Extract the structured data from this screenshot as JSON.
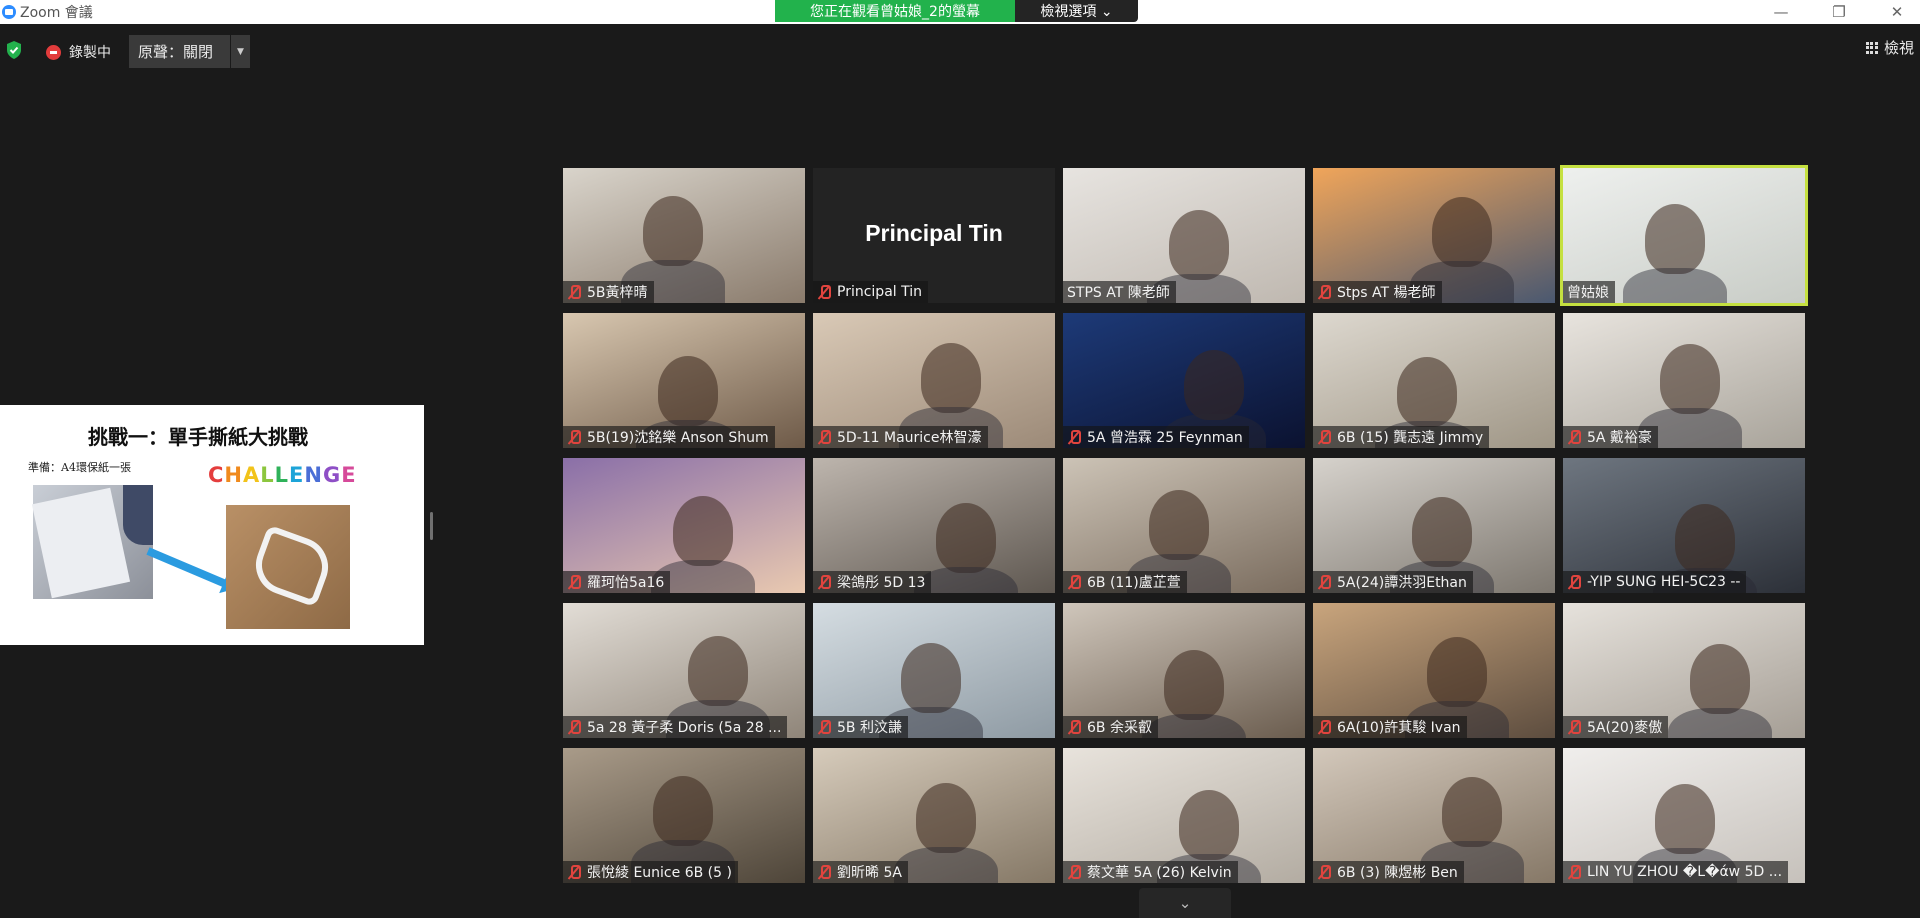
{
  "window": {
    "title": "Zoom 會議",
    "minimize": "—",
    "restore": "❐",
    "close": "✕"
  },
  "banner": {
    "viewing": "您正在觀看曾姑娘_2的螢幕",
    "view_options": "檢視選項 ⌄"
  },
  "toolbar": {
    "recording": "錄製中",
    "original_sound": "原聲：關閉",
    "dropdown": "▼",
    "view": "檢視"
  },
  "share": {
    "title": "挑戰一：單手撕紙大挑戰",
    "prep": "準備：A4環保紙一張",
    "challenge": [
      "C",
      "H",
      "A",
      "L",
      "L",
      "E",
      "N",
      "G",
      "E"
    ]
  },
  "accent": {
    "speaker_border": "#c5e040",
    "muted": "#e0443e",
    "banner_green": "#22b24c"
  },
  "participants": [
    {
      "name": "5B黃梓晴",
      "muted": true,
      "bg": [
        "#d9d4cb",
        "#8a7b6c"
      ]
    },
    {
      "name": "Principal Tin",
      "muted": true,
      "no_video": true,
      "big_name": "Principal Tin"
    },
    {
      "name": "STPS AT 陳老師",
      "muted": false,
      "bg": [
        "#e7e4e0",
        "#bfb8b0"
      ]
    },
    {
      "name": "Stps AT 楊老師",
      "muted": true,
      "bg": [
        "#f0a55a",
        "#4a5870"
      ]
    },
    {
      "name": "曾姑娘",
      "muted": false,
      "speaker": true,
      "bg": [
        "#eef0ee",
        "#c8ccc6"
      ]
    },
    {
      "name": "5B(19)沈銘樂 Anson Shum",
      "muted": true,
      "bg": [
        "#d8c7b0",
        "#6e5a48"
      ]
    },
    {
      "name": "5D-11 Maurice林智濠",
      "muted": true,
      "bg": [
        "#d9c9b6",
        "#9c8a78"
      ]
    },
    {
      "name": "5A 曾浩霖 25 Feynman",
      "muted": true,
      "bg": [
        "#1d3a78",
        "#0b1230"
      ]
    },
    {
      "name": "6B (15) 龔志遠 Jimmy",
      "muted": true,
      "bg": [
        "#ddd8cf",
        "#9f9686"
      ]
    },
    {
      "name": "5A 戴裕豪",
      "muted": true,
      "bg": [
        "#e8e4de",
        "#a8a39a"
      ]
    },
    {
      "name": "羅珂怡5a16",
      "muted": true,
      "bg": [
        "#8a6fa8",
        "#e9c9b0"
      ]
    },
    {
      "name": "梁鴿彤 5D 13",
      "muted": true,
      "bg": [
        "#bdb5ad",
        "#5e5750"
      ]
    },
    {
      "name": "6B (11)盧芷萱",
      "muted": true,
      "bg": [
        "#ccc3b6",
        "#7a6c5e"
      ]
    },
    {
      "name": "5A(24)譚洪羽Ethan",
      "muted": true,
      "bg": [
        "#d6d2cc",
        "#7d776f"
      ]
    },
    {
      "name": "-YIP SUNG HEI-5C23 --",
      "muted": true,
      "bg": [
        "#6e7680",
        "#2c3038"
      ]
    },
    {
      "name": "5a 28 黃子柔 Doris (5a 28 ...",
      "muted": true,
      "bg": [
        "#e2ddd6",
        "#8f8579"
      ]
    },
    {
      "name": "5B 利汶謙",
      "muted": true,
      "bg": [
        "#d5dde2",
        "#8e9aa3"
      ]
    },
    {
      "name": "6B 余采叡",
      "muted": true,
      "bg": [
        "#cfc6bb",
        "#6b5d4f"
      ]
    },
    {
      "name": "6A(10)許萁駿 Ivan",
      "muted": true,
      "bg": [
        "#c9a57d",
        "#5d4d3f"
      ]
    },
    {
      "name": "5A(20)麥傲",
      "muted": true,
      "bg": [
        "#e6e2dc",
        "#a59e95"
      ]
    },
    {
      "name": "張悅綾 Eunice 6B (5 )",
      "muted": true,
      "bg": [
        "#a99b89",
        "#4e4539"
      ]
    },
    {
      "name": "劉昕晞 5A",
      "muted": true,
      "bg": [
        "#d6cbbb",
        "#857866"
      ]
    },
    {
      "name": "蔡文華 5A (26) Kelvin",
      "muted": true,
      "bg": [
        "#e8e3dc",
        "#b3aca2"
      ]
    },
    {
      "name": "6B (3) 陳煜彬 Ben",
      "muted": true,
      "bg": [
        "#d3c8bb",
        "#867867"
      ]
    },
    {
      "name": "LIN YU ZHOU �L�άw 5D ...",
      "muted": true,
      "bg": [
        "#f0eeec",
        "#c6c1bb"
      ]
    }
  ],
  "bottom": {
    "chevron": "⌄"
  }
}
